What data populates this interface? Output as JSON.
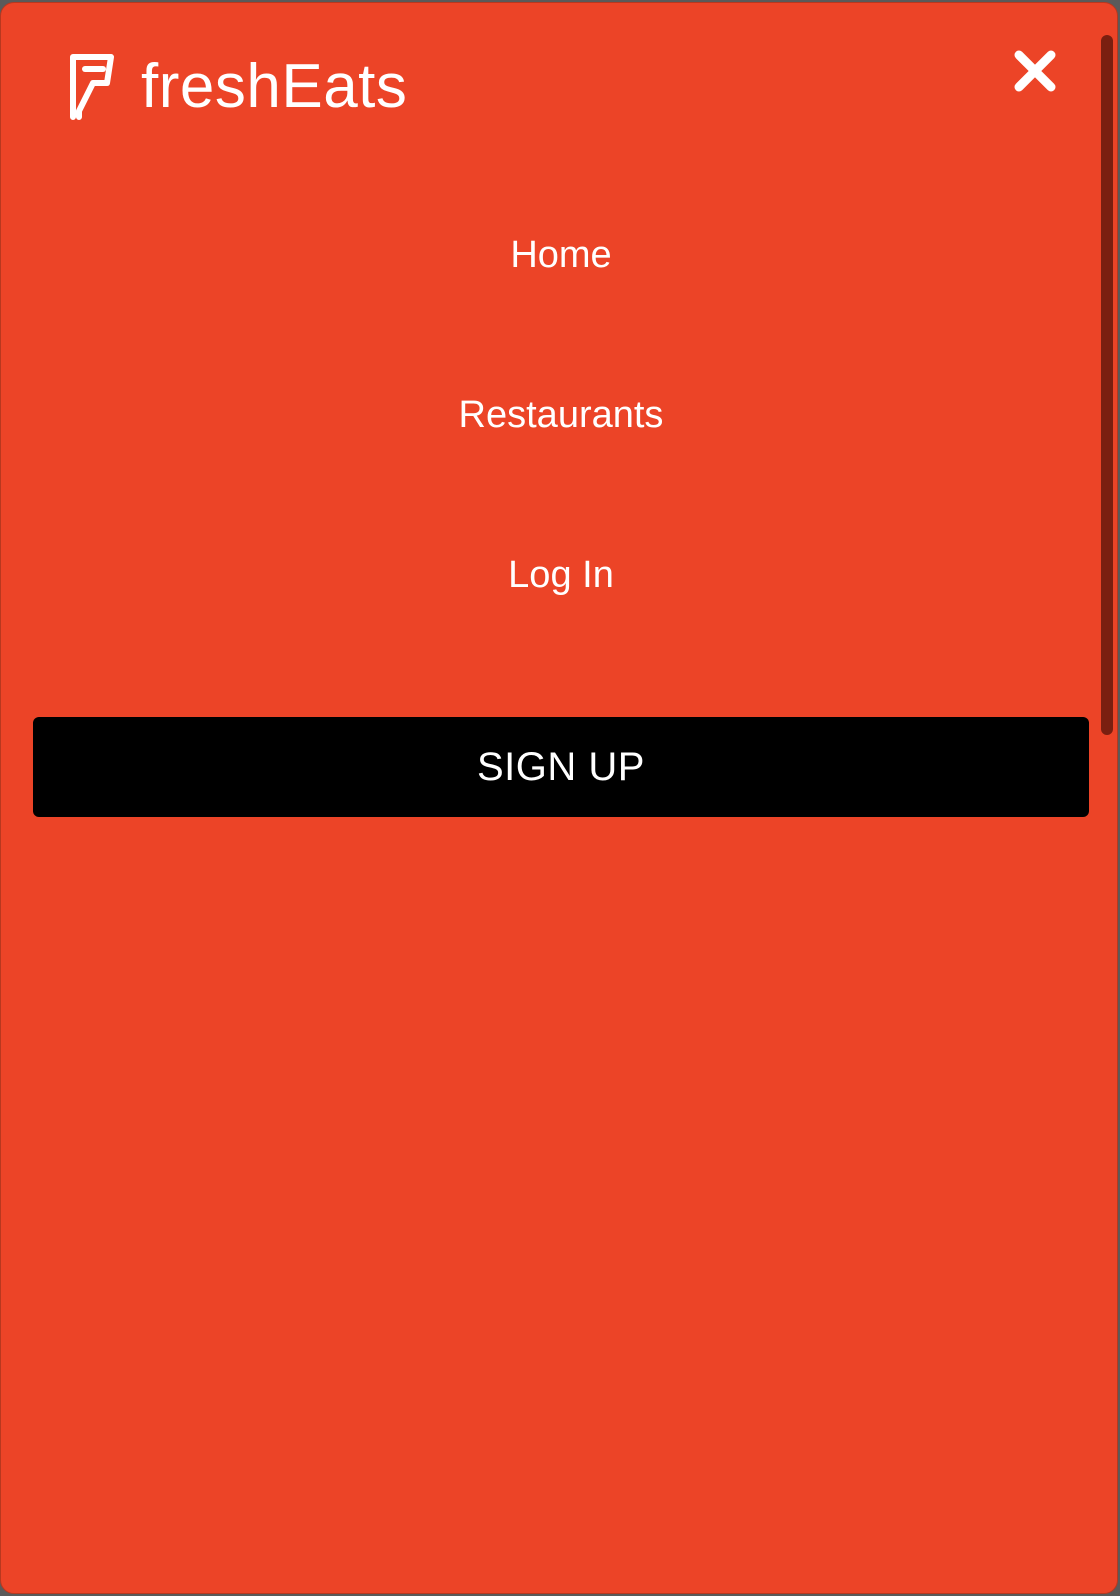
{
  "header": {
    "brand_name": "freshEats",
    "logo_icon": "foursquare-f-icon",
    "close_icon": "close-icon"
  },
  "nav": {
    "items": [
      {
        "label": "Home"
      },
      {
        "label": "Restaurants"
      },
      {
        "label": "Log In"
      }
    ]
  },
  "cta": {
    "signup_label": "SIGN UP"
  },
  "colors": {
    "background": "#ec4427",
    "button": "#000000",
    "text": "#ffffff",
    "scrollbar": "#7a1f10"
  }
}
